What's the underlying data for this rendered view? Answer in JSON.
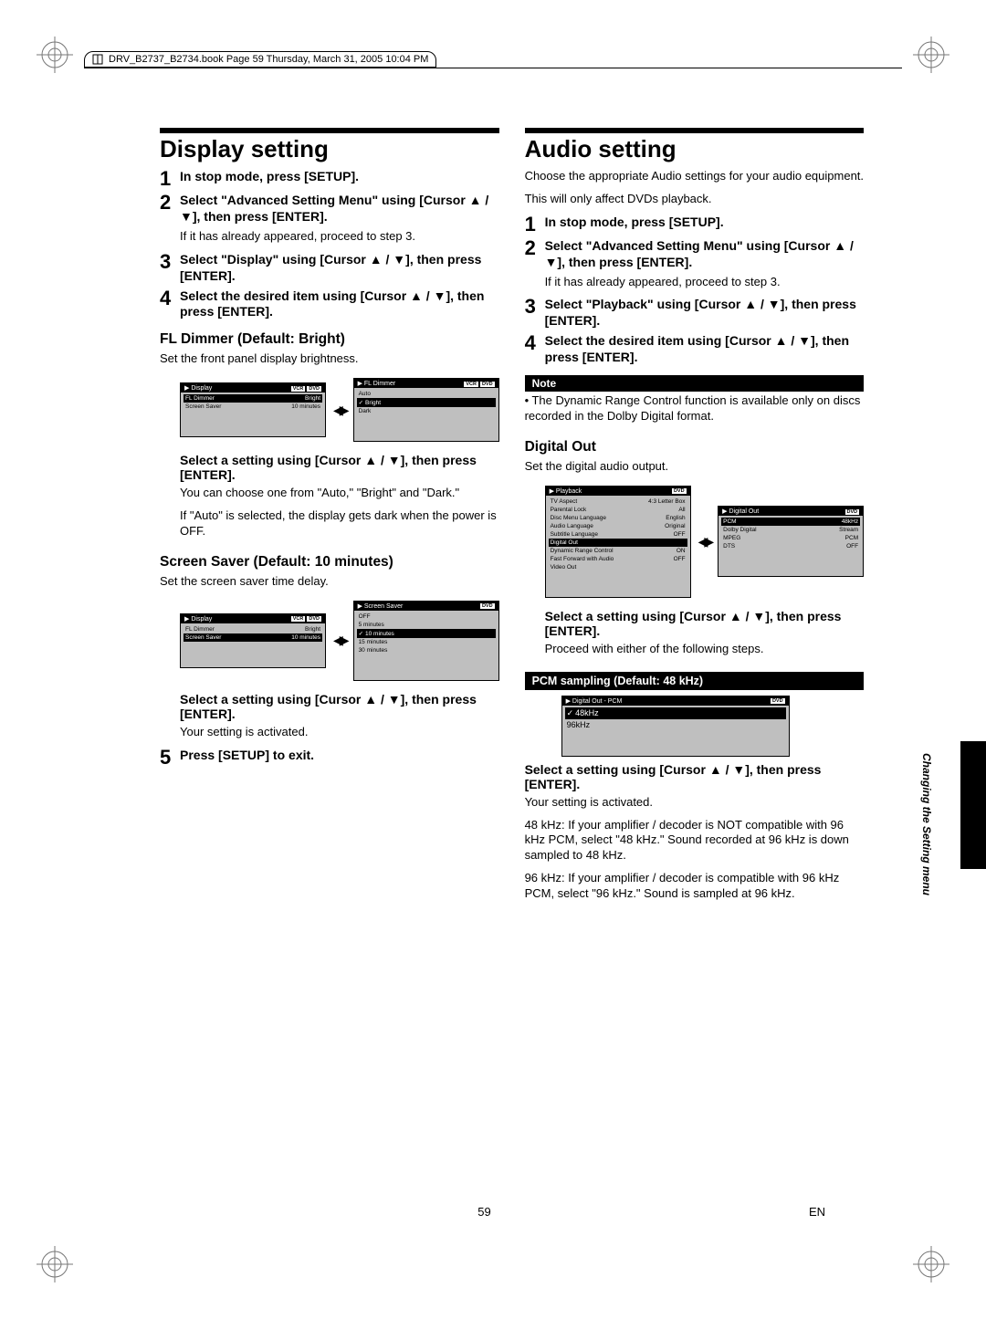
{
  "header": {
    "bookline": "DRV_B2737_B2734.book  Page 59  Thursday, March 31, 2005  10:04 PM"
  },
  "footer": {
    "page": "59",
    "lang": "EN"
  },
  "side_label": "Changing the Setting menu",
  "left": {
    "title": "Display setting",
    "step1": "In stop mode, press [SETUP].",
    "step2": "Select \"Advanced Setting Menu\" using [Cursor ▲ / ▼], then press [ENTER].",
    "step2_note": "If it has already appeared, proceed to step 3.",
    "step3": "Select \"Display\" using [Cursor ▲ / ▼], then press [ENTER].",
    "step4": "Select the desired item using [Cursor ▲ / ▼], then press [ENTER].",
    "fl_head": "FL Dimmer (Default: Bright)",
    "fl_body": "Set the front panel display brightness.",
    "osd_display": {
      "title": "Display",
      "tags": [
        "VCR",
        "DVD"
      ],
      "rows": [
        {
          "l": "FL Dimmer",
          "r": "Bright",
          "sel": true
        },
        {
          "l": "Screen Saver",
          "r": "10 minutes"
        }
      ]
    },
    "osd_fl": {
      "title": "FL Dimmer",
      "tags": [
        "VCR",
        "DVD"
      ],
      "rows": [
        {
          "l": "Auto"
        },
        {
          "l": "Bright",
          "sel": true,
          "chk": true
        },
        {
          "l": "Dark"
        }
      ]
    },
    "sel_head1": "Select a setting using [Cursor ▲ / ▼], then press [ENTER].",
    "sel_body1a": "You can choose one from \"Auto,\" \"Bright\" and \"Dark.\"",
    "sel_body1b": "If \"Auto\" is selected, the display gets dark when the power is OFF.",
    "ss_head": "Screen Saver (Default: 10 minutes)",
    "ss_body": "Set the screen saver time delay.",
    "osd_display2": {
      "title": "Display",
      "tags": [
        "VCR",
        "DVD"
      ],
      "rows": [
        {
          "l": "FL Dimmer",
          "r": "Bright"
        },
        {
          "l": "Screen Saver",
          "r": "10 minutes",
          "sel": true
        }
      ]
    },
    "osd_ss": {
      "title": "Screen Saver",
      "tags": [
        "DVD"
      ],
      "rows": [
        {
          "l": "OFF"
        },
        {
          "l": "5 minutes"
        },
        {
          "l": "10 minutes",
          "sel": true,
          "chk": true
        },
        {
          "l": "15 minutes"
        },
        {
          "l": "30 minutes"
        }
      ]
    },
    "sel_head2": "Select a setting using [Cursor ▲ / ▼], then press [ENTER].",
    "sel_body2": "Your setting is activated.",
    "step5": "Press [SETUP] to exit."
  },
  "right": {
    "title": "Audio setting",
    "intro1": "Choose the appropriate Audio settings for your audio equipment.",
    "intro2": "This will only affect DVDs playback.",
    "step1": "In stop mode, press [SETUP].",
    "step2": "Select \"Advanced Setting Menu\" using [Cursor ▲ / ▼], then press [ENTER].",
    "step2_note": "If it has already appeared, proceed to step 3.",
    "step3": "Select \"Playback\" using [Cursor ▲ / ▼], then press [ENTER].",
    "step4": "Select the desired item using [Cursor ▲ / ▼], then press [ENTER].",
    "note_label": "Note",
    "note_body": "• The Dynamic Range Control function is available only on discs recorded in the Dolby Digital format.",
    "digital_head": "Digital Out",
    "digital_body": "Set the digital audio output.",
    "osd_playback": {
      "title": "Playback",
      "tags": [
        "DVD"
      ],
      "rows": [
        {
          "l": "TV Aspect",
          "r": "4:3 Letter Box"
        },
        {
          "l": "Parental Lock",
          "r": "All"
        },
        {
          "l": "Disc Menu Language",
          "r": "English"
        },
        {
          "l": "Audio Language",
          "r": "Original"
        },
        {
          "l": "Subtitle Language",
          "r": "OFF"
        },
        {
          "l": "Digital Out",
          "sel": true
        },
        {
          "l": "Dynamic Range Control",
          "r": "ON"
        },
        {
          "l": "Fast Forward with Audio",
          "r": "OFF"
        },
        {
          "l": "Video Out"
        }
      ]
    },
    "osd_digital": {
      "title": "Digital Out",
      "tags": [
        "DVD"
      ],
      "rows": [
        {
          "l": "PCM",
          "r": "48kHz",
          "sel": true
        },
        {
          "l": "Dolby Digital",
          "r": "Stream"
        },
        {
          "l": "MPEG",
          "r": "PCM"
        },
        {
          "l": "DTS",
          "r": "OFF"
        }
      ]
    },
    "sel_head1": "Select a setting using [Cursor ▲ / ▼], then press [ENTER].",
    "sel_body1": "Proceed with either of the following steps.",
    "pcm_bar": "PCM sampling (Default: 48 kHz)",
    "osd_pcm": {
      "title": "Digital Out - PCM",
      "tags": [
        "DVD"
      ],
      "rows": [
        {
          "l": "48kHz",
          "sel": true,
          "chk": true
        },
        {
          "l": "96kHz"
        }
      ]
    },
    "sel_head2": "Select a setting using [Cursor ▲ / ▼], then press [ENTER].",
    "sel_body2": "Your setting is activated.",
    "khz48": "48 kHz: If your amplifier / decoder is NOT compatible with 96 kHz PCM, select \"48 kHz.\" Sound recorded at 96 kHz is down sampled to 48 kHz.",
    "khz96": "96 kHz: If your amplifier / decoder is compatible with 96 kHz PCM, select \"96 kHz.\" Sound is sampled at 96 kHz."
  }
}
